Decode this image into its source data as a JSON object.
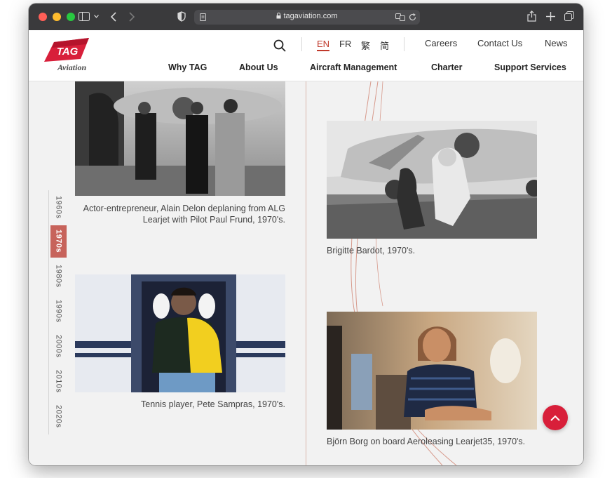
{
  "browser": {
    "url": "tagaviation.com"
  },
  "header": {
    "logo_mark": "TAG",
    "logo_text": "Aviation",
    "languages": [
      {
        "label": "EN",
        "active": true
      },
      {
        "label": "FR",
        "active": false
      },
      {
        "label": "繁",
        "active": false
      },
      {
        "label": "简",
        "active": false
      }
    ],
    "top_links": [
      "Careers",
      "Contact Us",
      "News"
    ],
    "main_nav": [
      "Why TAG",
      "About Us",
      "Aircraft Management",
      "Charter",
      "Support Services"
    ]
  },
  "timeline": {
    "decades": [
      "1960s",
      "1970s",
      "1980s",
      "1990s",
      "2000s",
      "2010s",
      "2020s"
    ],
    "active": "1970s"
  },
  "gallery": {
    "items": [
      {
        "caption": "Actor-entrepreneur, Alain Delon deplaning from ALG Learjet with Pilot Paul Frund, 1970's."
      },
      {
        "caption": "Brigitte Bardot, 1970's."
      },
      {
        "caption": "Tennis player, Pete Sampras, 1970's."
      },
      {
        "caption": "Björn Borg on board Aeroleasing Learjet35, 1970's."
      }
    ]
  },
  "colors": {
    "brand_red": "#d81f3a",
    "timeline_active": "#c7635b"
  },
  "icons": {
    "search": "search-icon",
    "scroll_top": "chevron-up-icon"
  }
}
